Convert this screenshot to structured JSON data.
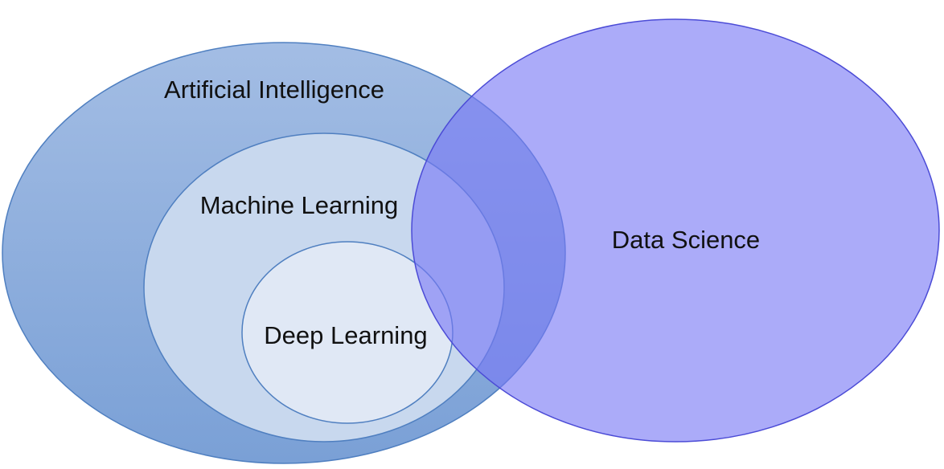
{
  "diagram": {
    "type": "venn",
    "sets": [
      {
        "id": "ai",
        "label": "Artificial Intelligence",
        "fill": "#86a9da",
        "stroke": "#4f7fc0"
      },
      {
        "id": "ml",
        "label": "Machine Learning",
        "fill": "#c5d6ec",
        "stroke": "#4f7fc0",
        "contained_in": "ai"
      },
      {
        "id": "dl",
        "label": "Deep Learning",
        "fill": "#dfe7f4",
        "stroke": "#4f7fc0",
        "contained_in": "ml"
      },
      {
        "id": "ds",
        "label": "Data Science",
        "fill": "#8f8ff5",
        "stroke": "#4b4bd6",
        "overlaps": [
          "ai",
          "ml",
          "dl"
        ]
      }
    ]
  }
}
